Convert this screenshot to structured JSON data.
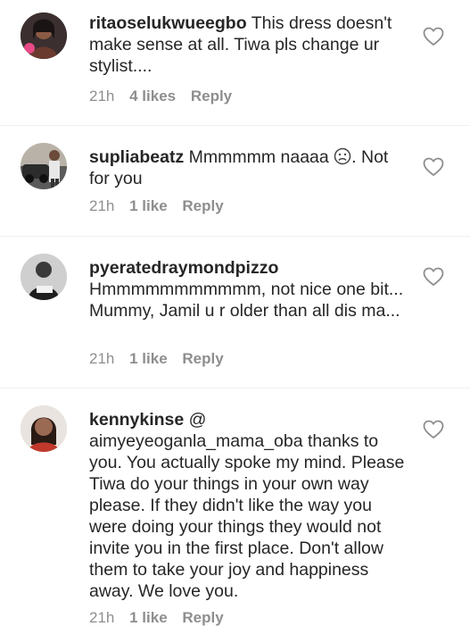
{
  "comments": [
    {
      "username": "ritaoselukwueegbo",
      "text": "This dress doesn't make sense at all. Tiwa pls change ur stylist....",
      "time": "21h",
      "likes": "4 likes",
      "reply": "Reply",
      "avatar_icon": "avatar-woman-portrait"
    },
    {
      "username": "supliabeatz",
      "text_before": "Mmmmmm naaaa",
      "emoji": "frowning-face",
      "text_after": ". Not for you",
      "time": "21h",
      "likes": "1 like",
      "reply": "Reply",
      "avatar_icon": "avatar-man-with-car"
    },
    {
      "username": "pyeratedraymondpizzo",
      "text": "Hmmmmmmmmmmm, not nice one bit... Mummy, Jamil u r older than all dis ma...",
      "time": "21h",
      "likes": "1 like",
      "reply": "Reply",
      "avatar_icon": "avatar-man-bw"
    },
    {
      "username": "kennykinse",
      "text": "@ aimyeyeoganla_mama_oba thanks to you. You actually spoke my mind. Please Tiwa do your things in your own way please. If they didn't like the way you were doing your things they would not invite you in the first place. Don't allow them to take your joy and happiness away. We love you.",
      "time": "21h",
      "likes": "1 like",
      "reply": "Reply",
      "avatar_icon": "avatar-woman-selfie"
    }
  ],
  "colors": {
    "text": "#262626",
    "meta": "#8e8e8e",
    "divider": "#efefef",
    "heart": "#8e8e8e"
  },
  "icons": {
    "like": "heart-outline-icon"
  }
}
